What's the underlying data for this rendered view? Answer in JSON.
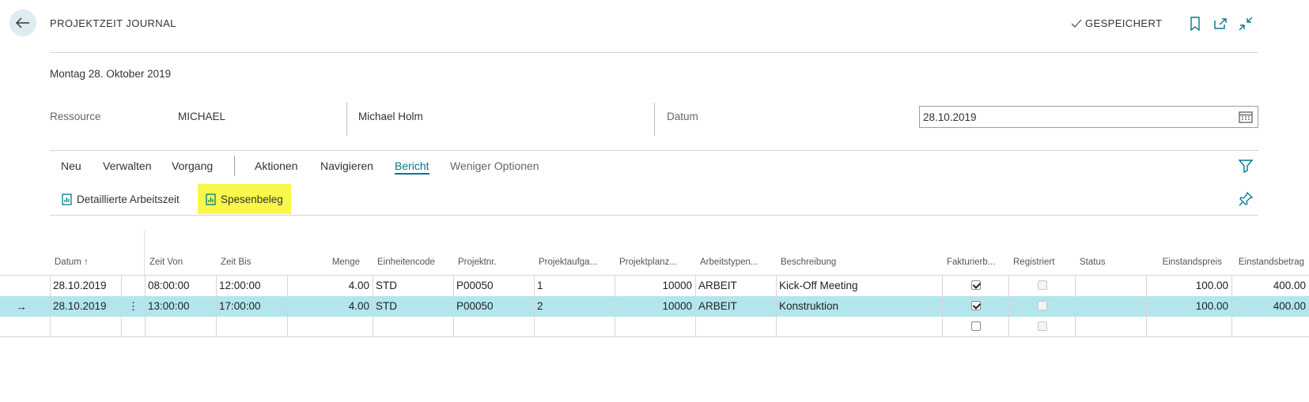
{
  "header": {
    "title": "PROJEKTZEIT JOURNAL",
    "saved_label": "GESPEICHERT",
    "icons": [
      "back-arrow-icon",
      "check-icon",
      "bookmark-icon",
      "open-new-window-icon",
      "collapse-icon"
    ]
  },
  "caption": "Montag 28. Oktober 2019",
  "fields": {
    "resource_label": "Ressource",
    "resource_code": "MICHAEL",
    "resource_name": "Michael Holm",
    "date_label": "Datum",
    "date_value": "28.10.2019"
  },
  "menu": {
    "items": [
      "Neu",
      "Verwalten",
      "Vorgang",
      "Aktionen",
      "Navigieren",
      "Bericht",
      "Weniger Optionen"
    ],
    "active": "Bericht"
  },
  "actions": [
    {
      "label": "Detaillierte Arbeitszeit",
      "icon": "report-icon"
    },
    {
      "label": "Spesenbeleg",
      "icon": "report-icon"
    }
  ],
  "columns": [
    "Datum ↑",
    "Zeit Von",
    "Zeit Bis",
    "Menge",
    "Einheitencode",
    "Projektnr.",
    "Projektaufga...",
    "Projektplanz...",
    "Arbeitstypen...",
    "Beschreibung",
    "Fakturierb...",
    "Registriert",
    "Status",
    "Einstandspreis",
    "Einstandsbetrag"
  ],
  "rows": [
    {
      "datum": "28.10.2019",
      "zeit_von": "08:00:00",
      "zeit_bis": "12:00:00",
      "menge": "4.00",
      "einheit": "STD",
      "projektnr": "P00050",
      "aufgabe": "1",
      "planzeile": "10000",
      "arbeitstyp": "ARBEIT",
      "beschreibung": "Kick-Off Meeting",
      "fakturierbar": true,
      "registriert": false,
      "status": "",
      "einstandspreis": "100.00",
      "einstandsbetrag": "400.00"
    },
    {
      "datum": "28.10.2019",
      "zeit_von": "13:00:00",
      "zeit_bis": "17:00:00",
      "menge": "4.00",
      "einheit": "STD",
      "projektnr": "P00050",
      "aufgabe": "2",
      "planzeile": "10000",
      "arbeitstyp": "ARBEIT",
      "beschreibung": "Konstruktion",
      "fakturierbar": true,
      "registriert": false,
      "status": "",
      "einstandspreis": "100.00",
      "einstandsbetrag": "400.00"
    },
    {
      "datum": "",
      "zeit_von": "",
      "zeit_bis": "",
      "menge": "",
      "einheit": "",
      "projektnr": "",
      "aufgabe": "",
      "planzeile": "",
      "arbeitstyp": "",
      "beschreibung": "",
      "fakturierbar": false,
      "registriert": false,
      "status": "",
      "einstandspreis": "",
      "einstandsbetrag": ""
    }
  ],
  "selected_row": 1,
  "colors": {
    "accent": "#00798c",
    "selected_row": "#b2e6ec",
    "highlight": "#f7f84a"
  }
}
